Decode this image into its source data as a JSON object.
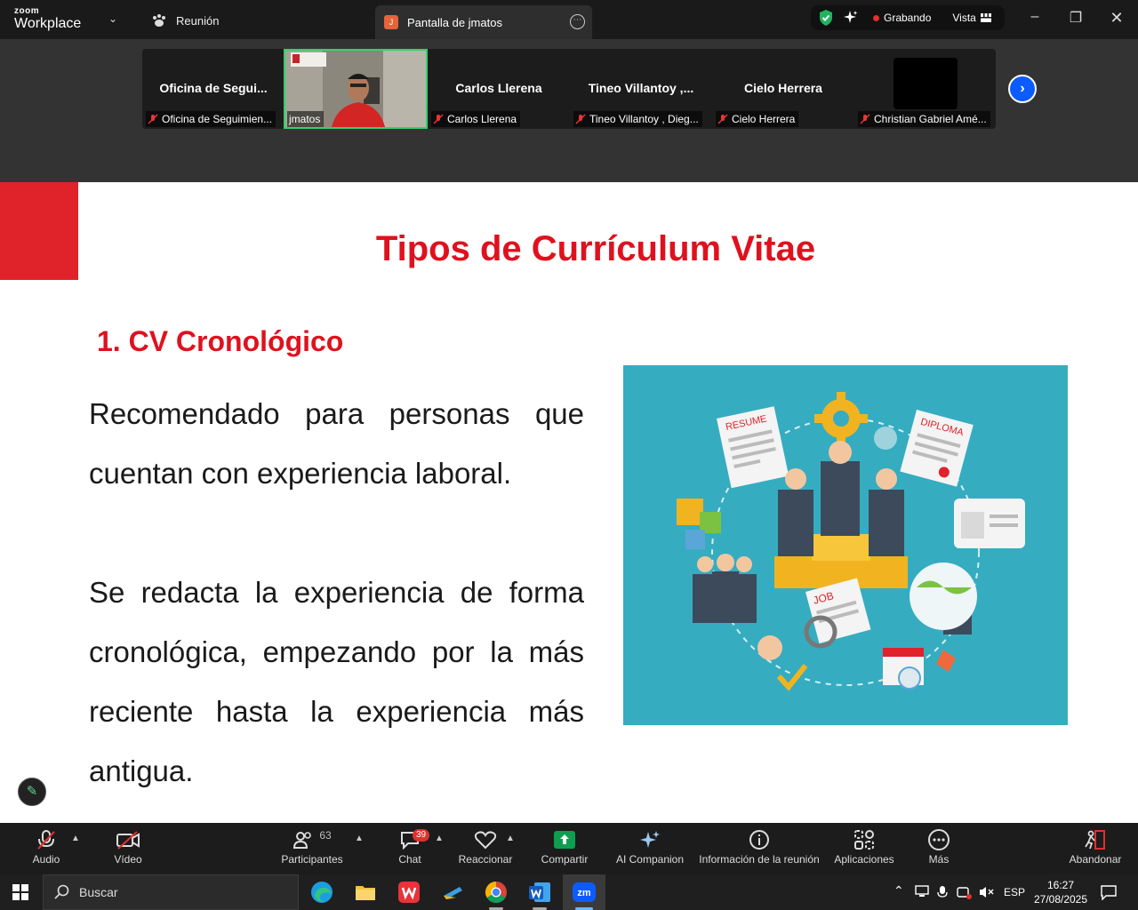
{
  "app": {
    "brand_small": "zoom",
    "brand_large": "Workplace"
  },
  "titlebar": {
    "meeting_tab": "Reunión",
    "share_tab": "Pantalla de jmatos",
    "share_tab_badge": "J",
    "recording": "Grabando",
    "view": "Vista"
  },
  "participants_strip": [
    {
      "tile_name": "Oficina  de  Segui...",
      "label": "Oficina de Seguimien...",
      "muted": true
    },
    {
      "tile_name": "",
      "label": "jmatos",
      "muted": false,
      "has_video": true
    },
    {
      "tile_name": "Carlos Llerena",
      "label": "Carlos Llerena",
      "muted": true
    },
    {
      "tile_name": "Tineo  Villantoy  ,...",
      "label": "Tineo Villantoy , Dieg...",
      "muted": true
    },
    {
      "tile_name": "Cielo Herrera",
      "label": "Cielo Herrera",
      "muted": true
    },
    {
      "tile_name": "",
      "label": "Christian Gabriel Amé...",
      "muted": true
    }
  ],
  "slide": {
    "title": "Tipos de Currículum Vitae",
    "subtitle": "1. CV Cronológico",
    "paragraph1": "Recomendado para personas que cuentan con experiencia laboral.",
    "paragraph2": "Se redacta la experiencia de forma cronológica, empezando por la más reciente hasta la experiencia más antigua.",
    "illustration": {
      "resume_label": "RESUME",
      "diploma_label": "DIPLOMA",
      "job_label": "JOB"
    }
  },
  "toolbar": {
    "audio": "Audio",
    "video": "Vídeo",
    "participants": "Participantes",
    "participants_count": "63",
    "chat": "Chat",
    "chat_badge": "39",
    "react": "Reaccionar",
    "share": "Compartir",
    "ai": "AI Companion",
    "info": "Información de la reunión",
    "apps": "Aplicaciones",
    "more": "Más",
    "leave": "Abandonar"
  },
  "taskbar": {
    "search_placeholder": "Buscar",
    "language": "ESP",
    "time": "16:27",
    "date": "27/08/2025"
  },
  "colors": {
    "slide_red": "#e0111e",
    "share_green": "#0e9e4f",
    "active_tile_border": "#2fd46a",
    "recording_dot": "#e0312e",
    "nav_blue": "#0b5cff"
  }
}
